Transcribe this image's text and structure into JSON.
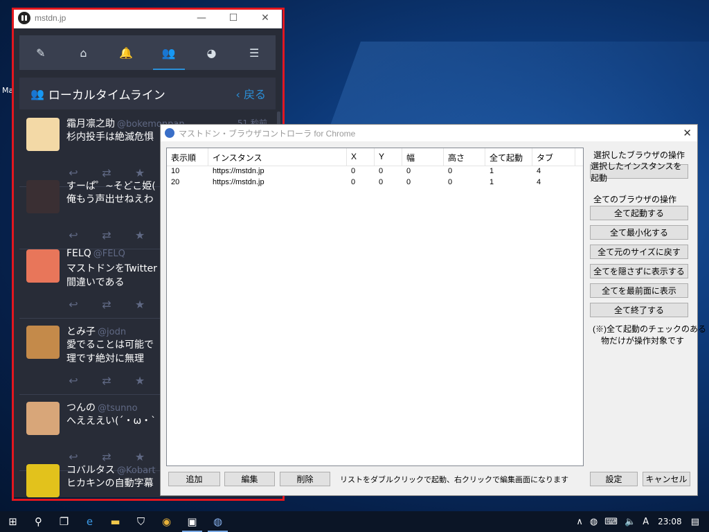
{
  "desktop": {
    "icon_label_fragment": "Ma"
  },
  "mastodon": {
    "window_title": "mstdn.jp",
    "window_controls": {
      "minimize": "—",
      "maximize": "☐",
      "close": "✕"
    },
    "nav": [
      {
        "icon": "pencil-icon",
        "glyph": "✎"
      },
      {
        "icon": "home-icon",
        "glyph": "⌂"
      },
      {
        "icon": "bell-icon",
        "glyph": "🔔"
      },
      {
        "icon": "users-icon",
        "glyph": "👥",
        "active": true
      },
      {
        "icon": "globe-icon",
        "glyph": "◕"
      },
      {
        "icon": "menu-icon",
        "glyph": "☰"
      }
    ],
    "column": {
      "title": "ローカルタイムライン",
      "back_label": "戻る",
      "back_glyph": "‹",
      "icon_glyph": "👥"
    },
    "statuses": [
      {
        "name": "霜月凛之助",
        "acct": "@bokemonpan",
        "time": "51 秒前",
        "text": "杉内投手は絶滅危惧",
        "avatar_color": "#f3d9a6"
      },
      {
        "name": "すーぱ゜~そどこ姫(",
        "acct": "",
        "time": "",
        "text": "俺もう声出せねえわ",
        "avatar_color": "#3a2f33"
      },
      {
        "name": "FELQ",
        "acct": "@FELQ",
        "time": "",
        "text": "マストドンをTwitter\n間違いである",
        "avatar_color": "#e8765a"
      },
      {
        "name": "とみ子",
        "acct": "@jodn",
        "time": "",
        "text": "愛でることは可能で\n理です絶対に無理",
        "avatar_color": "#c48a4a"
      },
      {
        "name": "つんの",
        "acct": "@tsunno",
        "time": "",
        "text": "へえええい(´・ω・`",
        "avatar_color": "#d8a679"
      },
      {
        "name": "コバルタス",
        "acct": "@Kobart",
        "time": "",
        "text": "ヒカキンの自動字幕",
        "avatar_color": "#e2c21c"
      }
    ],
    "actions": {
      "reply": "↩",
      "boost": "⇄",
      "favourite": "★"
    }
  },
  "controller": {
    "window_title": "マストドン・ブラウザコントローラ for Chrome",
    "close_glyph": "✕",
    "list": {
      "columns": [
        "表示順",
        "インスタンス",
        "X",
        "Y",
        "幅",
        "高さ",
        "全て起動",
        "タブ"
      ],
      "rows": [
        [
          "10",
          "https://mstdn.jp",
          "0",
          "0",
          "0",
          "0",
          "1",
          "4"
        ],
        [
          "20",
          "https://mstdn.jp",
          "0",
          "0",
          "0",
          "0",
          "1",
          "4"
        ]
      ]
    },
    "selected_section_label": "選択したブラウザの操作",
    "launch_selected_label": "選択したインスタンスを起動",
    "all_section_label": "全てのブラウザの操作",
    "all_buttons": [
      "全て起動する",
      "全て最小化する",
      "全て元のサイズに戻す",
      "全てを隠さずに表示する",
      "全てを最前面に表示",
      "全て終了する"
    ],
    "note": "(※)全て起動のチェックのある\n　物だけが操作対象です",
    "add_label": "追加",
    "edit_label": "編集",
    "delete_label": "削除",
    "hint": "リストをダブルクリックで起動、右クリックで編集画面になります",
    "settings_label": "設定",
    "cancel_label": "キャンセル"
  },
  "taskbar": {
    "buttons": [
      {
        "icon": "windows-start-icon",
        "glyph": "⊞"
      },
      {
        "icon": "search-icon",
        "glyph": "⚲"
      },
      {
        "icon": "task-view-icon",
        "glyph": "❐"
      },
      {
        "icon": "edge-icon",
        "glyph": "e"
      },
      {
        "icon": "file-explorer-icon",
        "glyph": "▬"
      },
      {
        "icon": "store-icon",
        "glyph": "⛉"
      },
      {
        "icon": "chrome-icon",
        "glyph": "◉"
      },
      {
        "icon": "photos-icon",
        "glyph": "▣"
      },
      {
        "icon": "controller-app-icon",
        "glyph": "◍"
      }
    ],
    "tray": {
      "chevron": "∧",
      "ime": "A",
      "time": "23:08"
    }
  }
}
